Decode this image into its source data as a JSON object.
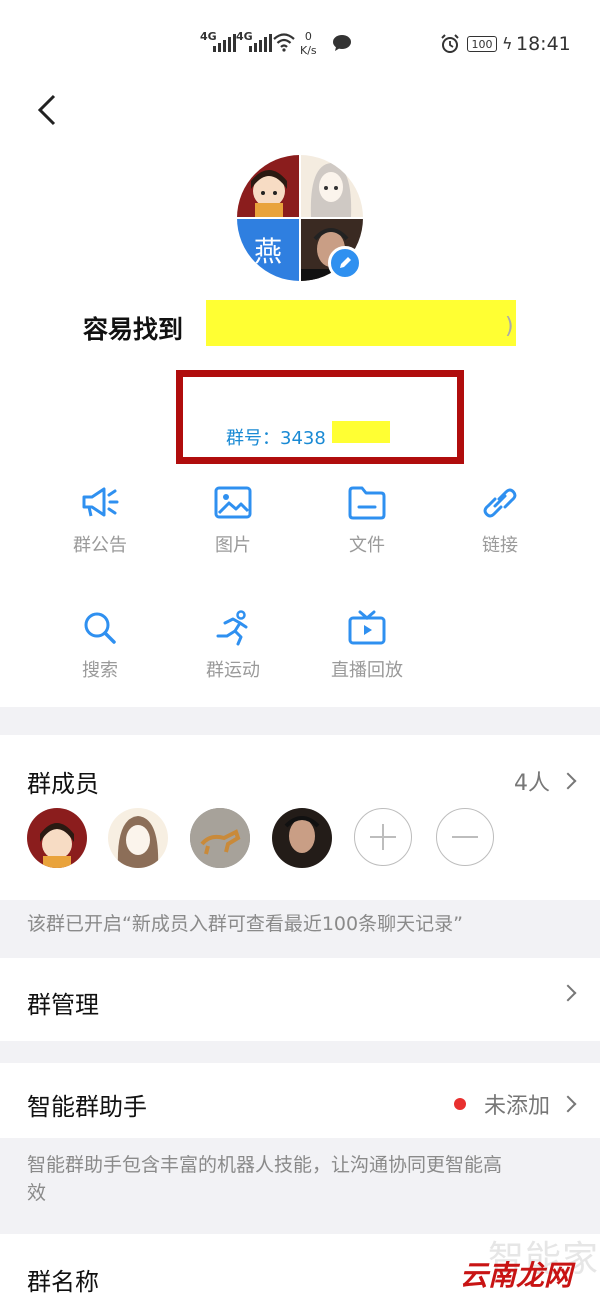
{
  "status_bar": {
    "net1": "4G",
    "net2": "4G",
    "speed_value": "0",
    "speed_unit": "K/s",
    "battery": "100",
    "time": "18:41"
  },
  "header": {
    "avatar_char": "燕",
    "group_name": "容易找到",
    "group_id_label": "群号：",
    "group_id_visible": "3438"
  },
  "features": [
    {
      "label": "群公告",
      "icon": "megaphone-icon"
    },
    {
      "label": "图片",
      "icon": "image-icon"
    },
    {
      "label": "文件",
      "icon": "folder-icon"
    },
    {
      "label": "链接",
      "icon": "link-icon"
    },
    {
      "label": "搜索",
      "icon": "search-icon"
    },
    {
      "label": "群运动",
      "icon": "running-icon"
    },
    {
      "label": "直播回放",
      "icon": "tv-icon"
    }
  ],
  "members": {
    "title": "群成员",
    "count": "4人"
  },
  "history_note": "该群已开启“新成员入群可查看最近100条聊天记录”",
  "management": {
    "title": "群管理"
  },
  "assistant": {
    "title": "智能群助手",
    "status": "未添加",
    "desc_line1": "智能群助手包含丰富的机器人技能，让沟通协同更智能高",
    "desc_line2": "效"
  },
  "group_name_row": {
    "title": "群名称"
  },
  "watermark": {
    "top": "智能家",
    "bottom": "云南龙网"
  },
  "colors": {
    "accent": "#2f90f0",
    "id_blue": "#1a8ad4",
    "alert_red": "#e8302f",
    "frame_red": "#b00d0d"
  }
}
